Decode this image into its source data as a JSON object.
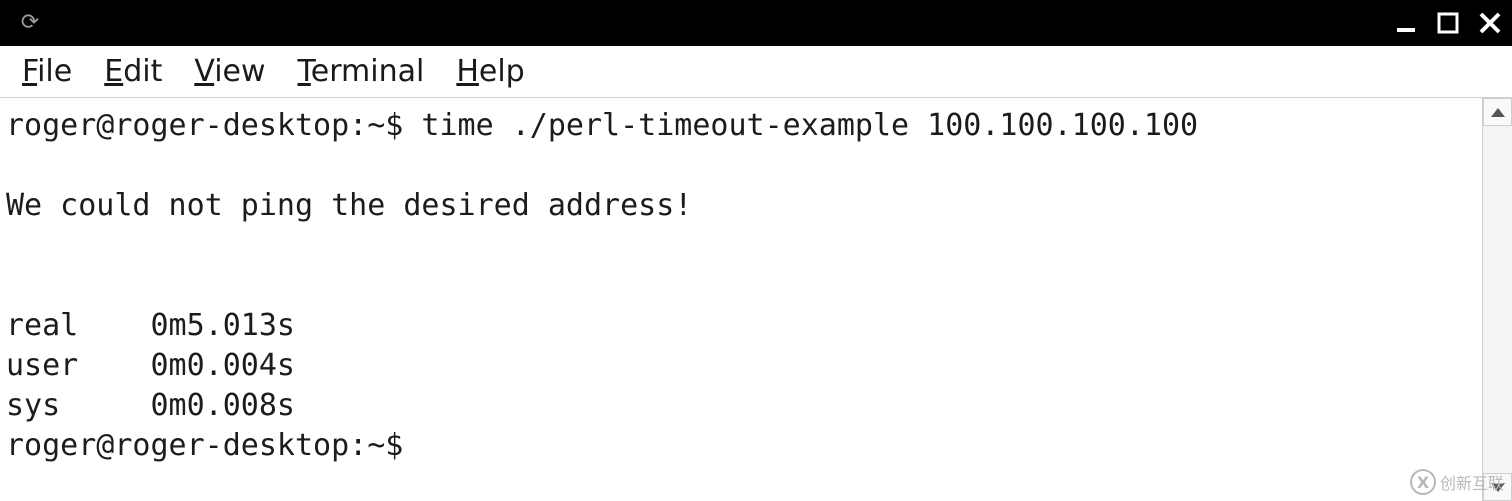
{
  "menubar": {
    "items": [
      {
        "label": "File",
        "accel_index": 0
      },
      {
        "label": "Edit",
        "accel_index": 0
      },
      {
        "label": "View",
        "accel_index": 0
      },
      {
        "label": "Terminal",
        "accel_index": 0
      },
      {
        "label": "Help",
        "accel_index": 0
      }
    ]
  },
  "terminal": {
    "prompt": "roger@roger-desktop:~$ ",
    "lines": [
      "roger@roger-desktop:~$ time ./perl-timeout-example 100.100.100.100",
      "",
      "We could not ping the desired address!",
      "",
      "",
      "real    0m5.013s",
      "user    0m0.004s",
      "sys     0m0.008s",
      "roger@roger-desktop:~$ "
    ],
    "command": "time ./perl-timeout-example 100.100.100.100",
    "timing": {
      "real": "0m5.013s",
      "user": "0m0.004s",
      "sys": "0m0.008s"
    }
  },
  "watermark": {
    "text": "创新互联"
  }
}
